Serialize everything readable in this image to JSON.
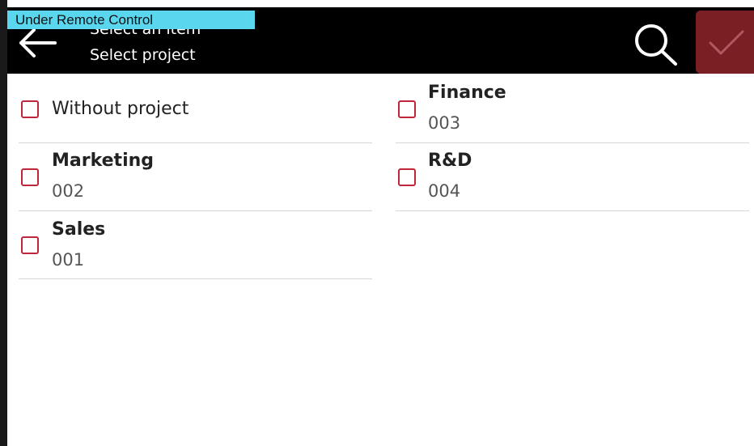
{
  "banner": {
    "text": "Under Remote Control"
  },
  "header": {
    "title": "Select an item",
    "subtitle": "Select project",
    "back_icon": "arrow-left-icon",
    "search_icon": "search-icon",
    "confirm_icon": "checkmark-icon",
    "confirm_color": "#7a1f24"
  },
  "colors": {
    "header_bg": "#000000",
    "banner_bg": "#5ad7ee",
    "checkbox_border": "#c0263a",
    "divider": "#d6d6d6"
  },
  "items": [
    {
      "name": "Without project",
      "code": "",
      "checked": false
    },
    {
      "name": "Finance",
      "code": "003",
      "checked": false
    },
    {
      "name": "Marketing",
      "code": "002",
      "checked": false
    },
    {
      "name": "R&D",
      "code": "004",
      "checked": false
    },
    {
      "name": "Sales",
      "code": "001",
      "checked": false
    }
  ]
}
